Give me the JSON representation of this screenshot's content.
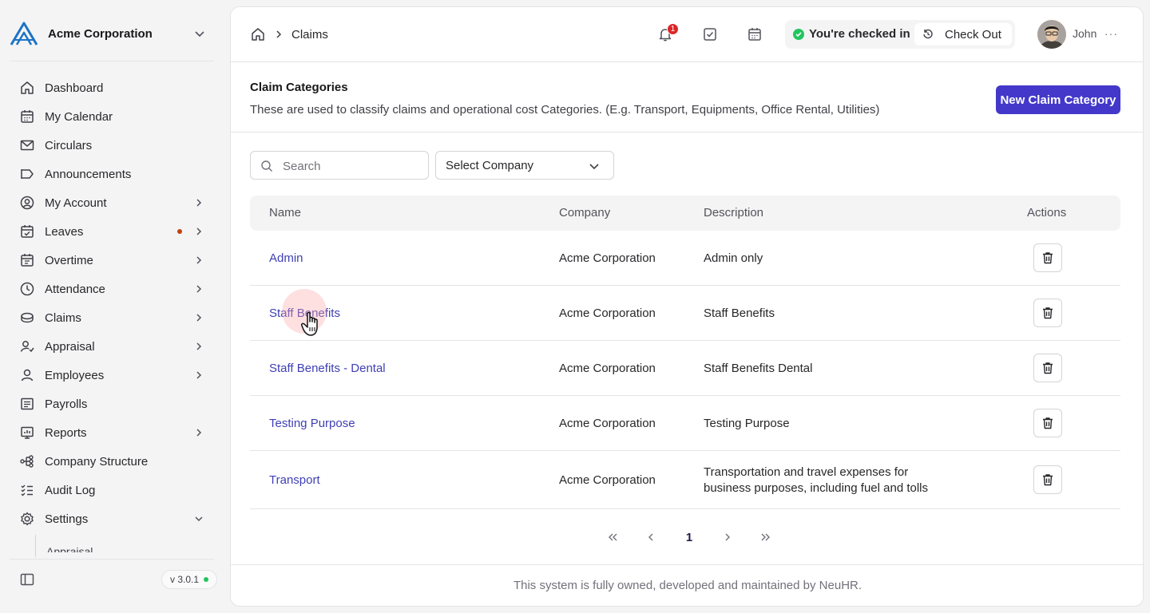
{
  "sidebar": {
    "company": "Acme Corporation",
    "items": [
      {
        "label": "Dashboard",
        "icon": "home-icon"
      },
      {
        "label": "My Calendar",
        "icon": "calendar-icon"
      },
      {
        "label": "Circulars",
        "icon": "mail-icon"
      },
      {
        "label": "Announcements",
        "icon": "megaphone-icon"
      },
      {
        "label": "My Account",
        "icon": "user-circle-icon"
      },
      {
        "label": "Leaves",
        "icon": "calendar-check-icon"
      },
      {
        "label": "Overtime",
        "icon": "calendar-clock-icon"
      },
      {
        "label": "Attendance",
        "icon": "clock-icon"
      },
      {
        "label": "Claims",
        "icon": "coins-icon"
      },
      {
        "label": "Appraisal",
        "icon": "user-star-icon"
      },
      {
        "label": "Employees",
        "icon": "user-icon"
      },
      {
        "label": "Payrolls",
        "icon": "receipt-icon"
      },
      {
        "label": "Reports",
        "icon": "chart-icon"
      },
      {
        "label": "Company Structure",
        "icon": "org-chart-icon"
      },
      {
        "label": "Audit Log",
        "icon": "list-check-icon"
      },
      {
        "label": "Settings",
        "icon": "gear-icon"
      }
    ],
    "sub_item": "Appraisal",
    "version": "v 3.0.1"
  },
  "header": {
    "breadcrumb": "Claims",
    "notification_count": "1",
    "checkin_status": "You're checked in",
    "checkout_label": "Check Out",
    "user_name": "John",
    "more": "···"
  },
  "section": {
    "title": "Claim Categories",
    "description": "These are used to classify claims and operational cost Categories. (E.g. Transport, Equipments, Office Rental, Utilities)",
    "new_button": "New Claim Category"
  },
  "filters": {
    "search_placeholder": "Search",
    "company_select": "Select Company"
  },
  "table": {
    "headers": {
      "name": "Name",
      "company": "Company",
      "description": "Description",
      "actions": "Actions"
    },
    "rows": [
      {
        "name": "Admin",
        "company": "Acme Corporation",
        "description": "Admin only"
      },
      {
        "name": "Staff Benefits",
        "company": "Acme Corporation",
        "description": "Staff Benefits"
      },
      {
        "name": "Staff Benefits - Dental",
        "company": "Acme Corporation",
        "description": "Staff Benefits Dental"
      },
      {
        "name": "Testing Purpose",
        "company": "Acme Corporation",
        "description": "Testing Purpose"
      },
      {
        "name": "Transport",
        "company": "Acme Corporation",
        "description_line1": "Transportation and travel expenses for",
        "description_line2": "business purposes, including fuel and tolls"
      }
    ]
  },
  "pagination": {
    "current_page": "1"
  },
  "footer": "This system is fully owned, developed and maintained by NeuHR.",
  "colors": {
    "accent": "#4338ca",
    "link": "#3f3fb5",
    "success": "#22c55e",
    "danger": "#dc2626"
  }
}
